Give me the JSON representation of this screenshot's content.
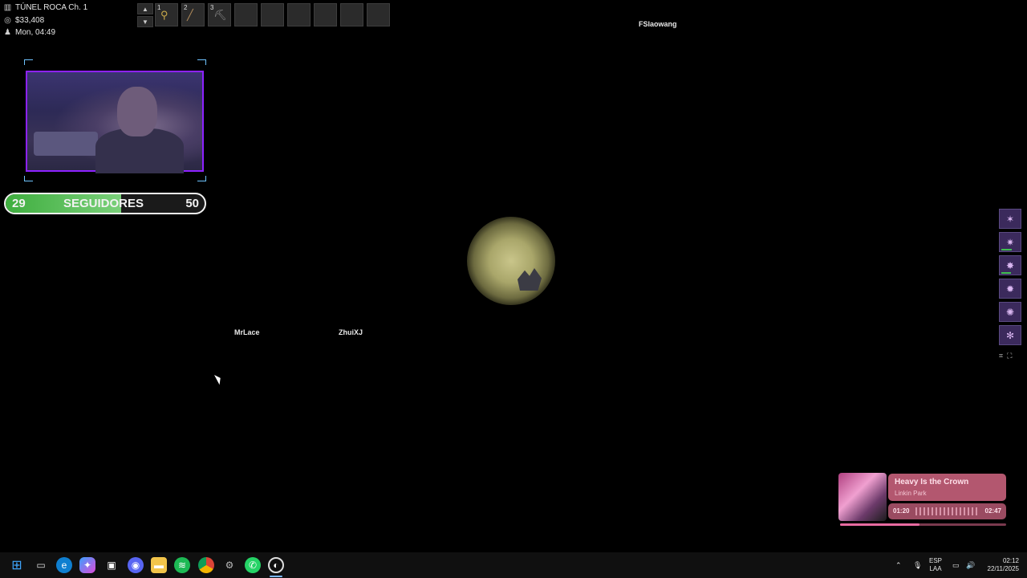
{
  "hud": {
    "location": "TÚNEL ROCA Ch. 1",
    "money": "$33,408",
    "time": "Mon, 04:49",
    "location_icon": "map-book-icon",
    "money_icon": "coins-icon",
    "time_icon": "player-icon"
  },
  "hotbar": {
    "slots": [
      {
        "number": "1",
        "item": "bicycle"
      },
      {
        "number": "2",
        "item": "fishing-rod"
      },
      {
        "number": "3",
        "item": "pickaxe"
      },
      {
        "number": "",
        "item": ""
      },
      {
        "number": "",
        "item": ""
      },
      {
        "number": "",
        "item": ""
      },
      {
        "number": "",
        "item": ""
      },
      {
        "number": "",
        "item": ""
      },
      {
        "number": "",
        "item": ""
      }
    ]
  },
  "players": {
    "p1": "FSlaowang",
    "p2": "MrLace",
    "p3": "ZhuiXJ"
  },
  "followers": {
    "current": "29",
    "label": "SEGUIDORES",
    "goal": "50",
    "progress": 0.58,
    "fill_color": "#4caf50"
  },
  "party": [
    {
      "name": "pokemon-slot-1",
      "hp": 0.0
    },
    {
      "name": "pokemon-slot-2",
      "hp": 0.55
    },
    {
      "name": "pokemon-slot-3",
      "hp": 0.5
    },
    {
      "name": "pokemon-slot-4",
      "hp": 0.0
    },
    {
      "name": "pokemon-slot-5",
      "hp": 0.0
    },
    {
      "name": "pokemon-slot-6",
      "hp": 0.0
    }
  ],
  "now_playing": {
    "title": "Heavy Is the Crown",
    "artist": "Linkin Park",
    "elapsed": "01:20",
    "duration": "02:47",
    "progress": 0.48
  },
  "taskbar": {
    "apps": [
      "windows-start",
      "task-view",
      "edge",
      "copilot",
      "store",
      "discord",
      "file-explorer",
      "spotify",
      "chrome",
      "app-extra",
      "whatsapp",
      "pokemmo"
    ],
    "language_1": "ESP",
    "language_2": "LAA",
    "clock_time": "02:12",
    "clock_date": "22/11/2025"
  },
  "colors": {
    "webcam_border": "#8d22ff",
    "follow_bar_border": "#f2f2f2",
    "now_playing_card": "#b3576f"
  }
}
